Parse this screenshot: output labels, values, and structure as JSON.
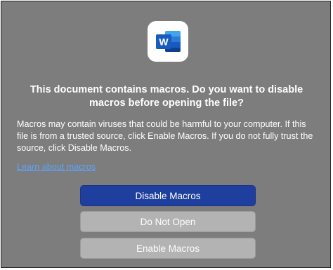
{
  "dialog": {
    "app_icon": "word-icon",
    "app_icon_letter": "W",
    "title": "This document contains macros. Do you want to disable macros before opening the file?",
    "message": "Macros may contain viruses that could be harmful to your computer.  If this file is from a trusted source, click Enable Macros. If you do not fully trust the source, click Disable Macros.",
    "learn_link": "Learn about macros",
    "buttons": {
      "disable": "Disable Macros",
      "do_not_open": "Do Not Open",
      "enable": "Enable Macros"
    }
  },
  "colors": {
    "dialog_background": "#7d7d7d",
    "primary_button": "#1f3f9e",
    "secondary_button": "#b3b3b3",
    "link": "#5ea3ff",
    "word_blue": "#2b579a"
  }
}
